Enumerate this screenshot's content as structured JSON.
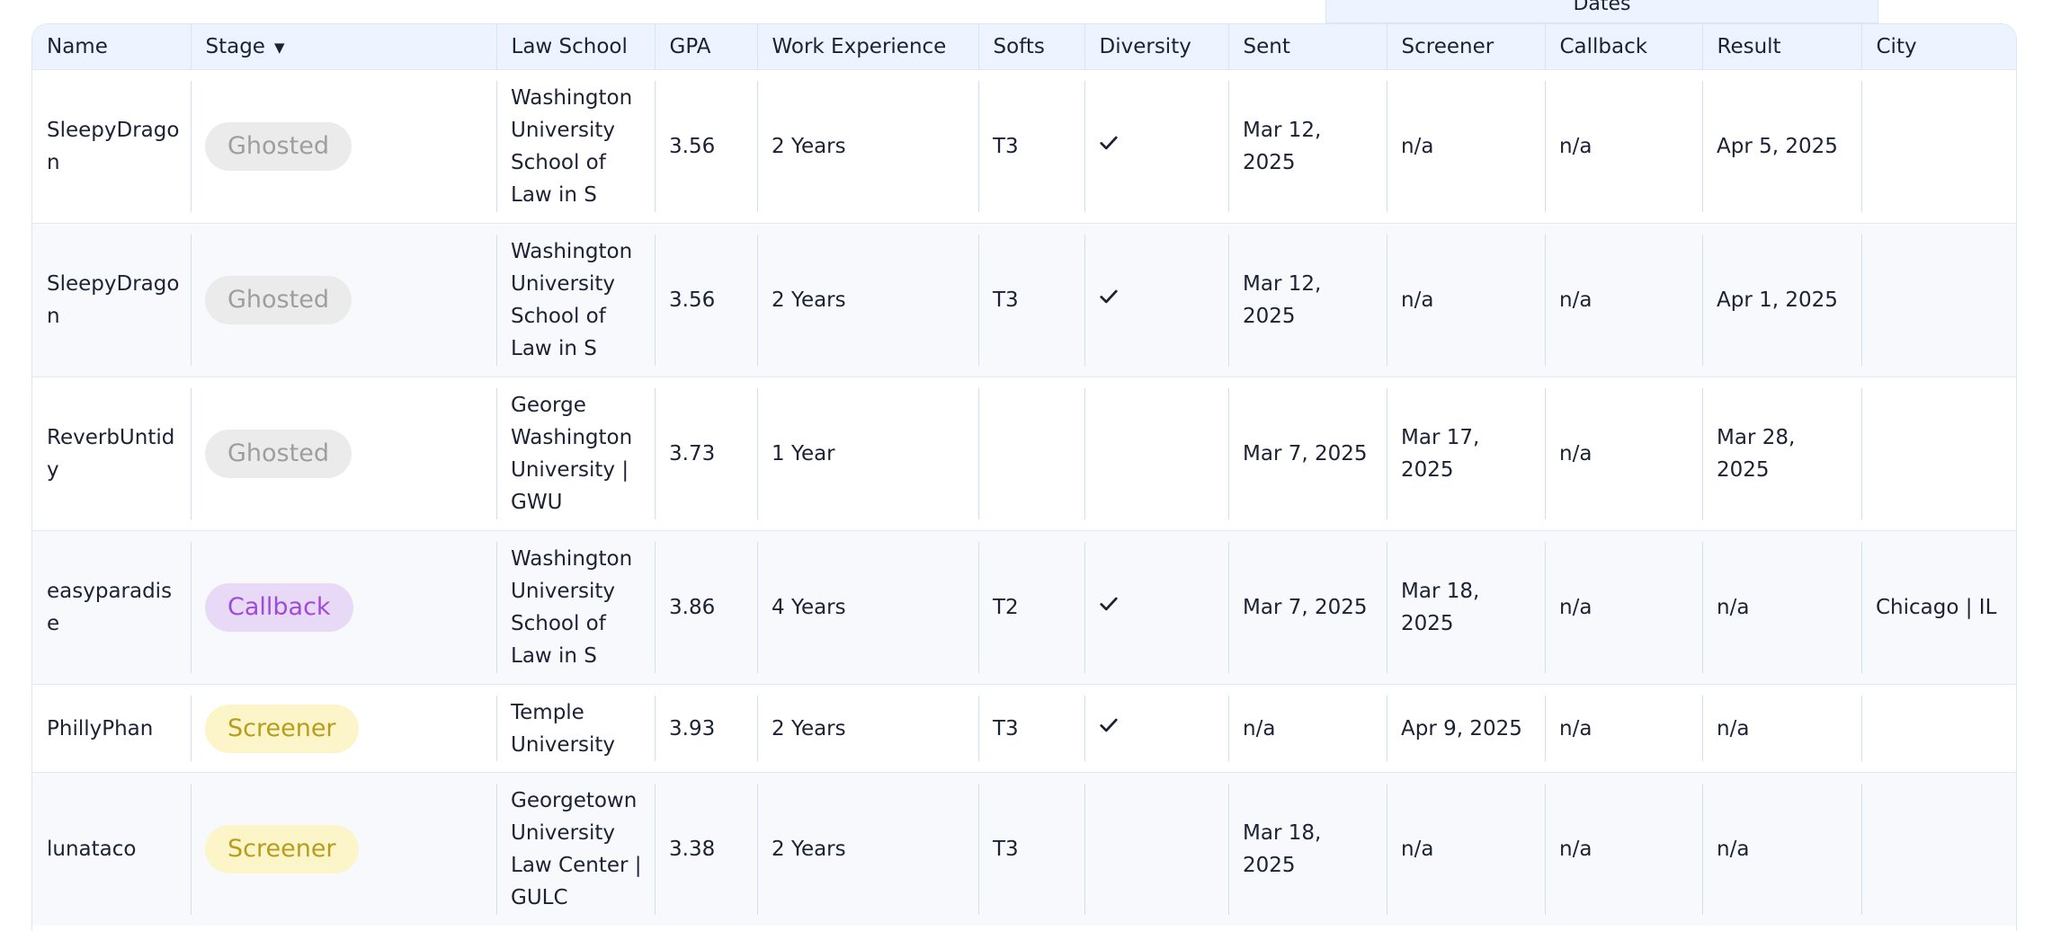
{
  "group_header": {
    "label": "Dates"
  },
  "columns": {
    "name": "Name",
    "stage": "Stage",
    "law_school": "Law School",
    "gpa": "GPA",
    "work_experience": "Work Experience",
    "softs": "Softs",
    "diversity": "Diversity",
    "sent": "Sent",
    "screener": "Screener",
    "callback": "Callback",
    "result": "Result",
    "city": "City"
  },
  "stage_colors": {
    "ghosted": "#9e9e9e",
    "callback": "#a04bd8",
    "screener": "#b79d1a"
  },
  "rows": [
    {
      "name": "SleepyDragon",
      "stage": "Ghosted",
      "law_school": "Washington University School of Law in S",
      "gpa": "3.56",
      "work_experience": "2 Years",
      "softs": "T3",
      "diversity": true,
      "sent": "Mar 12, 2025",
      "screener": "n/a",
      "callback": "n/a",
      "result": "Apr 5, 2025",
      "city": ""
    },
    {
      "name": "SleepyDragon",
      "stage": "Ghosted",
      "law_school": "Washington University School of Law in S",
      "gpa": "3.56",
      "work_experience": "2 Years",
      "softs": "T3",
      "diversity": true,
      "sent": "Mar 12, 2025",
      "screener": "n/a",
      "callback": "n/a",
      "result": "Apr 1, 2025",
      "city": ""
    },
    {
      "name": "ReverbUntidy",
      "stage": "Ghosted",
      "law_school": "George Washington University | GWU",
      "gpa": "3.73",
      "work_experience": "1 Year",
      "softs": "",
      "diversity": false,
      "sent": "Mar 7, 2025",
      "screener": "Mar 17, 2025",
      "callback": "n/a",
      "result": "Mar 28, 2025",
      "city": ""
    },
    {
      "name": "easyparadise",
      "stage": "Callback",
      "law_school": "Washington University School of Law in S",
      "gpa": "3.86",
      "work_experience": "4 Years",
      "softs": "T2",
      "diversity": true,
      "sent": "Mar 7, 2025",
      "screener": "Mar 18, 2025",
      "callback": "n/a",
      "result": "n/a",
      "city": "Chicago | IL"
    },
    {
      "name": "PhillyPhan",
      "stage": "Screener",
      "law_school": "Temple University",
      "gpa": "3.93",
      "work_experience": "2 Years",
      "softs": "T3",
      "diversity": true,
      "sent": "n/a",
      "screener": "Apr 9, 2025",
      "callback": "n/a",
      "result": "n/a",
      "city": ""
    },
    {
      "name": "lunataco",
      "stage": "Screener",
      "law_school": "Georgetown University Law Center | GULC",
      "gpa": "3.38",
      "work_experience": "2 Years",
      "softs": "T3",
      "diversity": false,
      "sent": "Mar 18, 2025",
      "screener": "n/a",
      "callback": "n/a",
      "result": "n/a",
      "city": ""
    }
  ]
}
